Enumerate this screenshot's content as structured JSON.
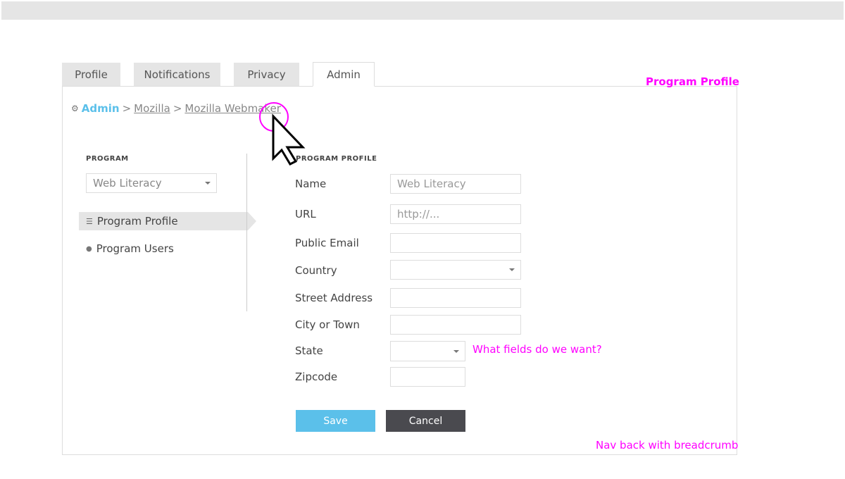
{
  "tabs": [
    {
      "label": "Profile"
    },
    {
      "label": "Notifications"
    },
    {
      "label": "Privacy"
    },
    {
      "label": "Admin"
    }
  ],
  "breadcrumb": {
    "items": [
      "Admin",
      "Mozilla",
      "Mozilla Webmaker"
    ],
    "separator": ">"
  },
  "notes": {
    "title": "Program Profile",
    "fields": "What fields do we want?",
    "nav": "Nav back with breadcrumb"
  },
  "sidebar": {
    "heading": "PROGRAM",
    "program_select": "Web Literacy",
    "items": [
      {
        "label": "Program Profile",
        "icon": "list-icon",
        "active": true
      },
      {
        "label": "Program Users",
        "icon": "user-icon",
        "active": false
      }
    ]
  },
  "form": {
    "heading": "PROGRAM PROFILE",
    "fields": [
      {
        "label": "Name",
        "value": "Web Literacy"
      },
      {
        "label": "URL",
        "placeholder": "http://..."
      },
      {
        "label": "Public Email",
        "value": ""
      },
      {
        "label": "Country",
        "value": ""
      },
      {
        "label": "Street Address",
        "value": ""
      },
      {
        "label": "City or Town",
        "value": ""
      },
      {
        "label": "State",
        "value": ""
      },
      {
        "label": "Zipcode",
        "value": ""
      }
    ],
    "save": "Save",
    "cancel": "Cancel"
  },
  "colors": {
    "accent": "#5bc0ea",
    "annotation": "#ff00ff",
    "cancel": "#4a4a4f"
  }
}
